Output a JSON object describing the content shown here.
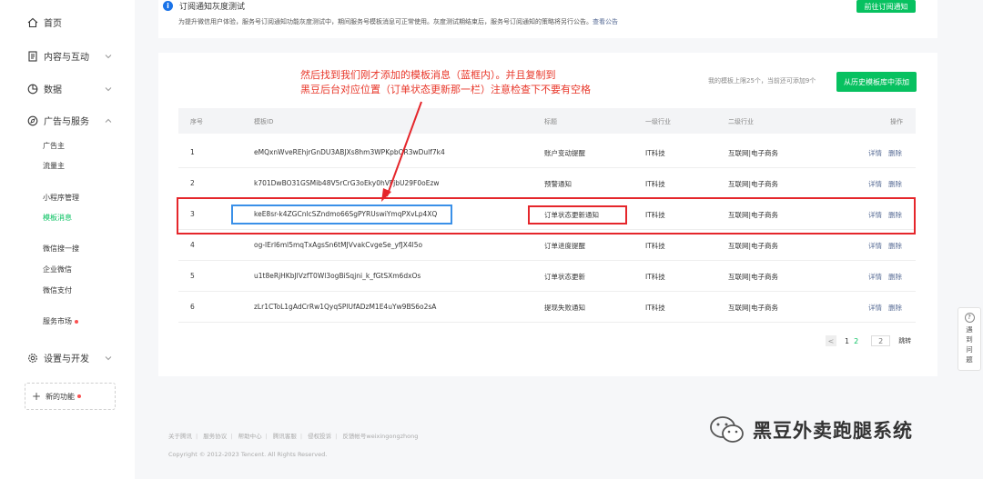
{
  "sidebar": {
    "home": "首页",
    "content": "内容与互动",
    "data": "数据",
    "ads": "广告与服务",
    "ads_sub": [
      "广告主",
      "流量主",
      "小程序管理",
      "模板消息",
      "微信搜一搜",
      "企业微信",
      "微信支付",
      "服务市场"
    ],
    "settings": "设置与开发",
    "new_func": "新的功能"
  },
  "notice": {
    "title": "订阅通知灰度测试",
    "text": "为提升微信用户体验，服务号订阅通知功能灰度测试中，期间服务号模板消息可正常使用。灰度测试期结束后，服务号订阅通知的策略将另行公告。",
    "link": "查看公告",
    "button": "前往订阅通知"
  },
  "main": {
    "quota": "我的模板上限25个，当前还可添加9个",
    "add_button": "从历史模板库中添加",
    "headers": {
      "no": "序号",
      "id": "模板ID",
      "title": "标题",
      "ind1": "一级行业",
      "ind2": "二级行业",
      "op": "操作"
    },
    "rows": [
      {
        "no": "1",
        "id": "eMQxnWveREhjrGnDU3ABJXs8hm3WPKpbOR3wDulf7k4",
        "title": "账户变动提醒",
        "ind1": "IT科技",
        "ind2": "互联网|电子商务",
        "op1": "详情",
        "op2": "删除"
      },
      {
        "no": "2",
        "id": "k701DwBO31GSMib48V5rCrG3oEky0hVFjbU29F0oEzw",
        "title": "预警通知",
        "ind1": "IT科技",
        "ind2": "互联网|电子商务",
        "op1": "详情",
        "op2": "删除"
      },
      {
        "no": "3",
        "id": "keE8sr-k4ZGCnlcSZndmo66SgPYRUswiYmqPXvLp4XQ",
        "title": "订单状态更新通知",
        "ind1": "IT科技",
        "ind2": "互联网|电子商务",
        "op1": "详情",
        "op2": "删除"
      },
      {
        "no": "4",
        "id": "og-lErl6ml5mqTxAgsSn6tMJVvakCvgeSe_yfJX4l5o",
        "title": "订单进度提醒",
        "ind1": "IT科技",
        "ind2": "互联网|电子商务",
        "op1": "详情",
        "op2": "删除"
      },
      {
        "no": "5",
        "id": "u1t8eRjHKbJlVzfT0Wl3ogBiSqjni_k_fGtSXm6dxOs",
        "title": "订单状态更新",
        "ind1": "IT科技",
        "ind2": "互联网|电子商务",
        "op1": "详情",
        "op2": "删除"
      },
      {
        "no": "6",
        "id": "zLr1CToL1gAdCrRw1QyqSPlUfADzM1E4uYw9BS6o2sA",
        "title": "提现失败通知",
        "ind1": "IT科技",
        "ind2": "互联网|电子商务",
        "op1": "详情",
        "op2": "删除"
      }
    ],
    "pager": {
      "prev": "<",
      "pages": [
        "1",
        "2"
      ],
      "current": "2",
      "input": "2",
      "jump": "跳转"
    }
  },
  "annotation": {
    "line1": "然后找到我们刚才添加的模板消息（蓝框内）。并且复制到",
    "line2": "黑豆后台对应位置（订单状态更新那一栏）注意检查下不要有空格"
  },
  "help": {
    "line1": "遇",
    "line2": "到",
    "line3": "问",
    "line4": "题"
  },
  "footer": {
    "links": [
      "关于腾讯",
      "服务协议",
      "帮助中心",
      "腾讯客服",
      "侵权投诉",
      "反馈帐号weixingongzhong"
    ],
    "copyright": "Copyright © 2012-2023 Tencent. All Rights Reserved."
  },
  "watermark": "黑豆外卖跑腿系统",
  "colors": {
    "brand_green": "#07c160",
    "link": "#576b95",
    "annotation_red": "#e5262b",
    "highlight_blue": "#3a90e8"
  }
}
